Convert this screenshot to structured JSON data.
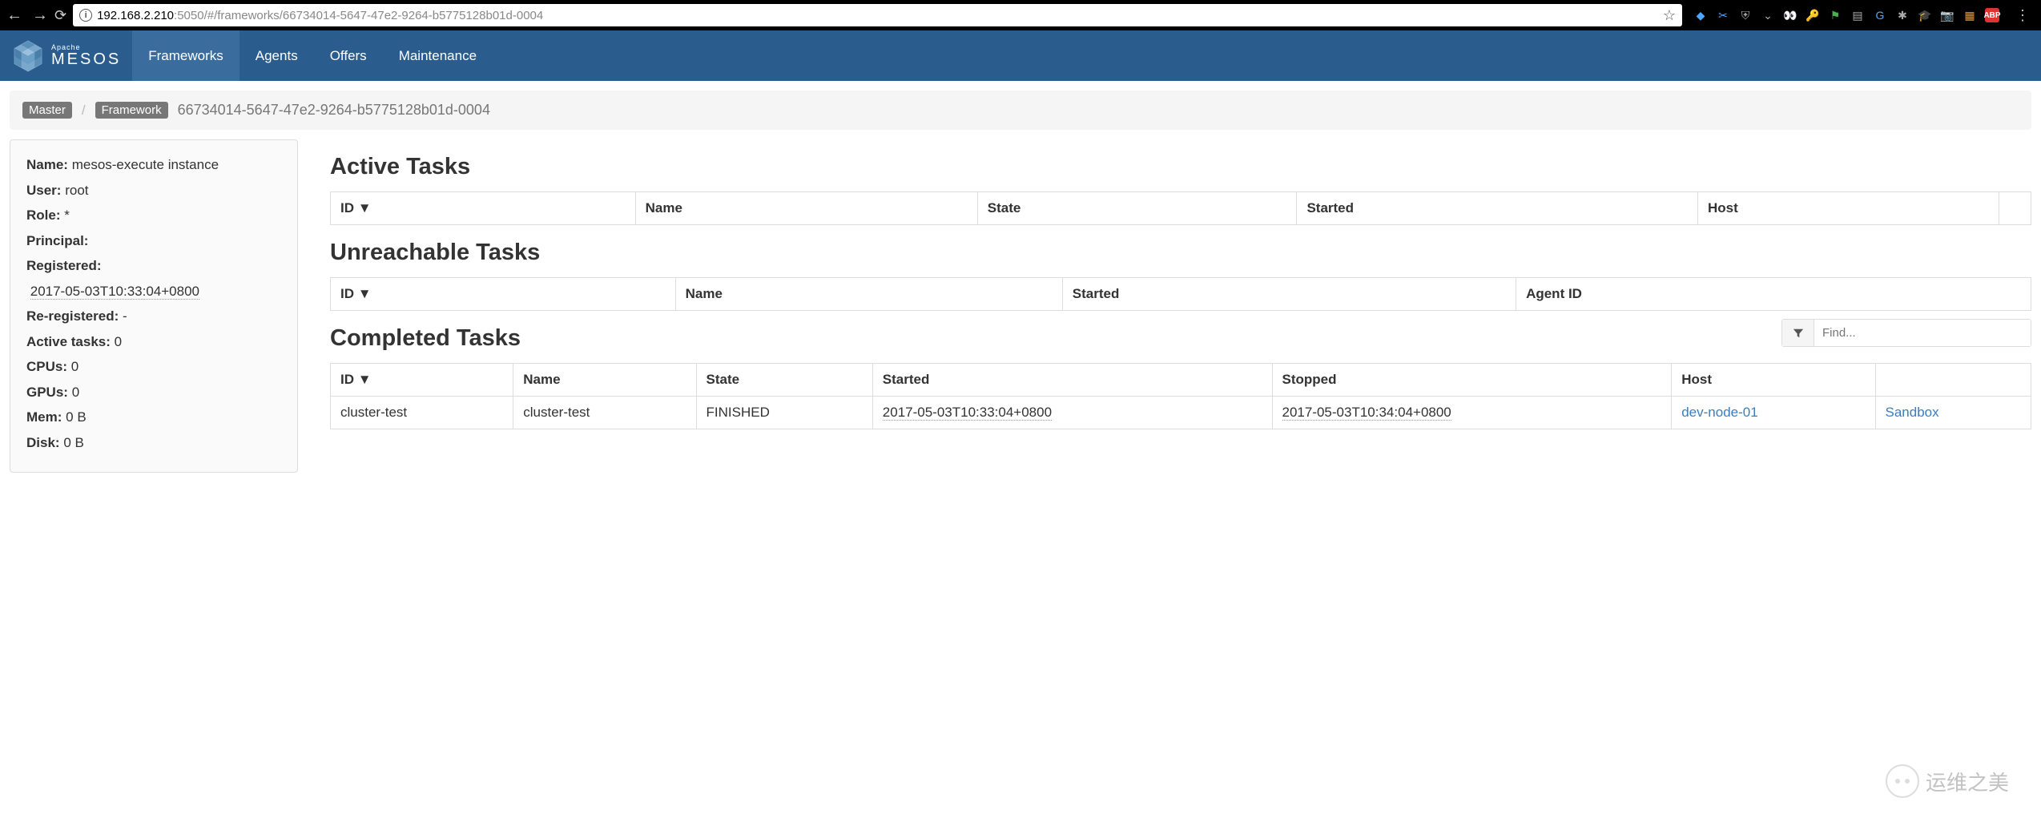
{
  "browser": {
    "url_host": "192.168.2.210",
    "url_rest": ":5050/#/frameworks/66734014-5647-47e2-9264-b5775128b01d-0004"
  },
  "nav": {
    "brand_apache": "Apache",
    "brand_mesos": "MESOS",
    "items": [
      "Frameworks",
      "Agents",
      "Offers",
      "Maintenance"
    ]
  },
  "breadcrumb": {
    "master": "Master",
    "framework": "Framework",
    "id": "66734014-5647-47e2-9264-b5775128b01d-0004"
  },
  "sidebar": {
    "labels": {
      "name": "Name:",
      "user": "User:",
      "role": "Role:",
      "principal": "Principal:",
      "registered": "Registered:",
      "reregistered": "Re-registered:",
      "active": "Active tasks:",
      "cpus": "CPUs:",
      "gpus": "GPUs:",
      "mem": "Mem:",
      "disk": "Disk:"
    },
    "name": "mesos-execute instance",
    "user": "root",
    "role": "*",
    "principal": "",
    "registered": "2017-05-03T10:33:04+0800",
    "reregistered": "-",
    "active_tasks": "0",
    "cpus": "0",
    "gpus": "0",
    "mem": "0 B",
    "disk": "0 B"
  },
  "sections": {
    "active": {
      "title": "Active Tasks",
      "columns": [
        "ID ▼",
        "Name",
        "State",
        "Started",
        "Host",
        ""
      ]
    },
    "unreachable": {
      "title": "Unreachable Tasks",
      "columns": [
        "ID ▼",
        "Name",
        "Started",
        "Agent ID"
      ]
    },
    "completed": {
      "title": "Completed Tasks",
      "filter_placeholder": "Find...",
      "columns": [
        "ID ▼",
        "Name",
        "State",
        "Started",
        "Stopped",
        "Host",
        ""
      ],
      "rows": [
        {
          "id": "cluster-test",
          "name": "cluster-test",
          "state": "FINISHED",
          "started": "2017-05-03T10:33:04+0800",
          "stopped": "2017-05-03T10:34:04+0800",
          "host": "dev-node-01",
          "sandbox": "Sandbox"
        }
      ]
    }
  },
  "watermark": "运维之美"
}
